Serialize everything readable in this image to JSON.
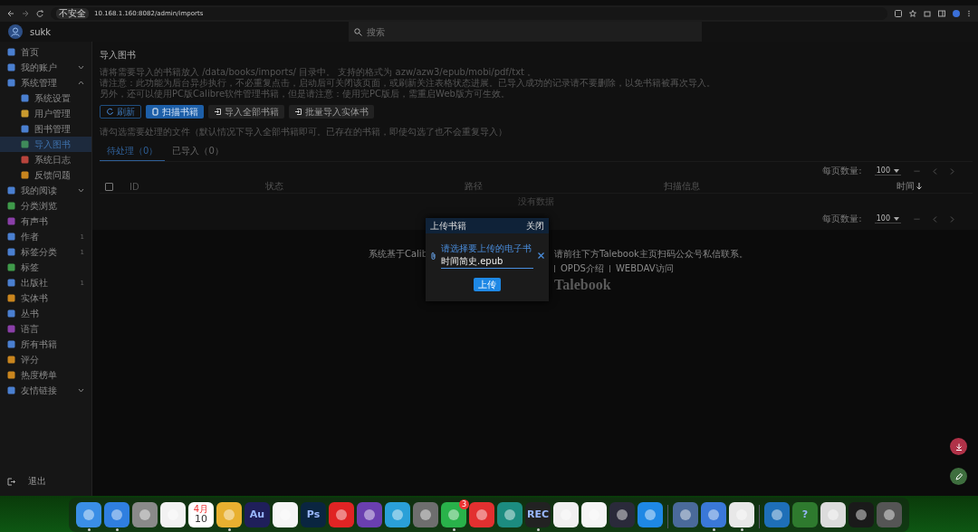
{
  "browser": {
    "warning": "不安全",
    "url": "10.168.1.160:8082/admin/imports"
  },
  "app_bar": {
    "user": "sukk",
    "search": {
      "placeholder": "搜索"
    }
  },
  "sidebar": {
    "items": [
      {
        "label": "首页",
        "color": "#4a7fd0",
        "selected": false
      },
      {
        "label": "我的账户",
        "color": "#4a7fd0",
        "selected": false,
        "expanded": false
      },
      {
        "label": "系统管理",
        "color": "#4a7fd0",
        "selected": false,
        "expanded": true,
        "children": [
          {
            "label": "系统设置",
            "color": "#4a7fd0",
            "selected": false
          },
          {
            "label": "用户管理",
            "color": "#c99a2e",
            "selected": false
          },
          {
            "label": "图书管理",
            "color": "#4a7fd0",
            "selected": false
          },
          {
            "label": "导入图书",
            "color": "#3f8a5a",
            "selected": true
          },
          {
            "label": "系统日志",
            "color": "#b8443c",
            "selected": false
          },
          {
            "label": "反馈问题",
            "color": "#c9851e",
            "selected": false
          }
        ]
      },
      {
        "label": "我的阅读",
        "color": "#4a7fd0",
        "selected": false,
        "expanded": false
      },
      {
        "label": "分类浏览",
        "color": "#3f9a4a",
        "selected": false
      },
      {
        "label": "有声书",
        "color": "#8a3fa8",
        "selected": false
      },
      {
        "label": "作者",
        "color": "#4a7fd0",
        "selected": false,
        "count": "1"
      },
      {
        "label": "标签分类",
        "color": "#4a7fd0",
        "selected": false,
        "count": "1"
      },
      {
        "label": "标签",
        "color": "#3f9a4a",
        "selected": false
      },
      {
        "label": "出版社",
        "color": "#4a7fd0",
        "selected": false,
        "count": "1"
      },
      {
        "label": "实体书",
        "color": "#c9851e",
        "selected": false
      },
      {
        "label": "丛书",
        "color": "#4a7fd0",
        "selected": false
      },
      {
        "label": "语言",
        "color": "#8a3fa8",
        "selected": false
      },
      {
        "label": "所有书籍",
        "color": "#4a7fd0",
        "selected": false
      },
      {
        "label": "评分",
        "color": "#c9851e",
        "selected": false
      },
      {
        "label": "热度榜单",
        "color": "#c9851e",
        "selected": false
      },
      {
        "label": "友情链接",
        "color": "#4a7fd0",
        "selected": false,
        "expanded": false
      }
    ],
    "logout": "退出"
  },
  "page": {
    "title": "导入图书",
    "notes": [
      "请将需要导入的书籍放入 /data/books/imports/ 目录中。 支持的格式为 azw/azw3/epub/mobi/pdf/txt 。",
      "请注意：此功能为后台异步执行，不必重复点击，启动后可关闭该页面，或刷新关注表格状态进展。已导入成功的记录请不要删除，以免书籍被再次导入。",
      "另外，还可以使用PC版Calibre软件管理书籍，但是请注意：使用完PC版后，需重启Web版方可生效。"
    ],
    "buttons": [
      {
        "label": "刷新",
        "kind": "outline"
      },
      {
        "label": "扫描书籍",
        "kind": "primary"
      },
      {
        "label": "导入全部书籍",
        "kind": "tonal"
      },
      {
        "label": "批量导入实体书",
        "kind": "tonal"
      }
    ],
    "hint": "请勾选需要处理的文件（默认情况下导入全部书籍即可。已存在的书籍，即使勾选了也不会重复导入）",
    "tabs": [
      {
        "label": "待处理（0）",
        "selected": true
      },
      {
        "label": "已导入（0）",
        "selected": false
      }
    ],
    "table": {
      "pagination_top": {
        "label": "每页数量:",
        "value": "100",
        "range": "—"
      },
      "select_all": {
        "checked": false
      },
      "columns": [
        {
          "label": "ID"
        },
        {
          "label": "状态"
        },
        {
          "label": "路径"
        },
        {
          "label": "扫描信息"
        },
        {
          "label": "时间",
          "sorted_descending": true
        }
      ],
      "empty": "没有数据",
      "pagination_bottom": {
        "label": "每页数量:",
        "value": "100",
        "range": "—"
      }
    }
  },
  "footer": {
    "left": "系统基于Calib",
    "right": "请前往下方Talebook主页扫码公众号私信联系。",
    "links": [
      "OPDS介绍",
      "WEBDAV访问"
    ],
    "brand": "Talebook"
  },
  "dialog": {
    "title": "上传书籍",
    "close": "关闭",
    "field": {
      "label": "请选择要上传的电子书",
      "value": "时间简史.epub"
    },
    "submit": "上传"
  },
  "fabs": [
    {
      "kind": "download",
      "color": "#b03248"
    },
    {
      "kind": "edit",
      "color": "#3e6e3e"
    }
  ],
  "dock": [
    {
      "kind": "app",
      "color": "#3a8ee6",
      "running": true
    },
    {
      "kind": "app",
      "color": "#2f7fe0",
      "running": true
    },
    {
      "kind": "app",
      "color": "#8a8a8a",
      "running": false
    },
    {
      "kind": "app",
      "color": "#f2f2f2",
      "running": false
    },
    {
      "kind": "calendar",
      "color": "#ffffff",
      "month": "4月",
      "day": "10",
      "running": false
    },
    {
      "kind": "app",
      "color": "#e8b030",
      "running": true
    },
    {
      "kind": "text",
      "color": "#1f1f5a",
      "text": "Au",
      "running": false
    },
    {
      "kind": "app",
      "color": "#f5f5f5",
      "running": false
    },
    {
      "kind": "text",
      "color": "#0a2540",
      "text": "Ps",
      "running": false
    },
    {
      "kind": "app",
      "color": "#e02424",
      "running": false
    },
    {
      "kind": "app",
      "color": "#6a3fb0",
      "running": false
    },
    {
      "kind": "app",
      "color": "#2aa0d8",
      "running": false
    },
    {
      "kind": "app",
      "color": "#6e6e6e",
      "running": false
    },
    {
      "kind": "badge",
      "color": "#29b24a",
      "badge": "3",
      "running": true
    },
    {
      "kind": "app",
      "color": "#e23030",
      "running": false
    },
    {
      "kind": "app",
      "color": "#1c8c80",
      "running": false
    },
    {
      "kind": "text",
      "color": "#222222",
      "text": "REC",
      "running": true
    },
    {
      "kind": "app",
      "color": "#f0f0f0",
      "running": false
    },
    {
      "kind": "app",
      "color": "#f5f5f5",
      "running": false
    },
    {
      "kind": "app",
      "color": "#2a2a3a",
      "running": false
    },
    {
      "kind": "app",
      "color": "#1e88e5",
      "running": false
    },
    {
      "kind": "separator"
    },
    {
      "kind": "app",
      "color": "#4a6a9a",
      "running": false
    },
    {
      "kind": "app",
      "color": "#3a78d8",
      "running": true
    },
    {
      "kind": "app",
      "color": "#e8e8e8",
      "running": true
    },
    {
      "kind": "separator"
    },
    {
      "kind": "app",
      "color": "#1e6fb8",
      "running": false
    },
    {
      "kind": "text",
      "color": "#2e7a2e",
      "text": "?",
      "running": false
    },
    {
      "kind": "app",
      "color": "#dcdcdc",
      "running": false
    },
    {
      "kind": "app",
      "color": "#1a1a1a",
      "running": false
    },
    {
      "kind": "app",
      "color": "#555555",
      "running": false
    }
  ]
}
